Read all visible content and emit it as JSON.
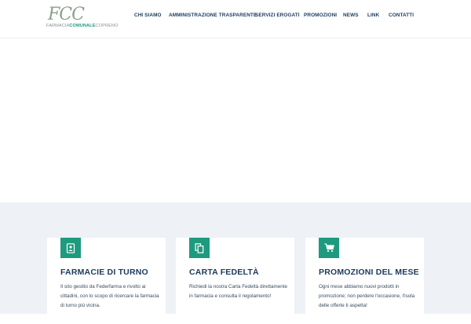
{
  "logo": {
    "monogram": "FCC",
    "word1": "FARMACIA",
    "word2": "COMUNALE",
    "word3": "COPRENO"
  },
  "nav": {
    "items": [
      {
        "label": "CHI SIAMO"
      },
      {
        "label": "AMMINISTRAZIONE TRASPARENTE"
      },
      {
        "label": "SERVIZI EROGATI"
      },
      {
        "label": "PROMOZIONI"
      },
      {
        "label": "NEWS"
      },
      {
        "label": "LINK"
      },
      {
        "label": "CONTATTI"
      }
    ]
  },
  "colors": {
    "accent": "#1e9a7f",
    "navy": "#1b3a5c",
    "section_bg": "#eef1f6"
  },
  "cards": [
    {
      "icon": "contact-book-icon",
      "title": "FARMACIE DI TURNO",
      "text": "Il sito gestito da Federfarma e rivolto ai cittadini, con lo scopo di ricercare la farmacia di turno più vicina."
    },
    {
      "icon": "copy-documents-icon",
      "title": "CARTA FEDELTÀ",
      "text": "Richiedi la nostra Carta Fedeltà direttamente in farmacia e consulta il regolamento!"
    },
    {
      "icon": "shopping-cart-icon",
      "title": "PROMOZIONI DEL MESE",
      "text": "Ogni mese abbiamo nuovi prodotti in promozione; non perdere l'occasione, l'isola delle offerte ti aspetta!"
    }
  ]
}
